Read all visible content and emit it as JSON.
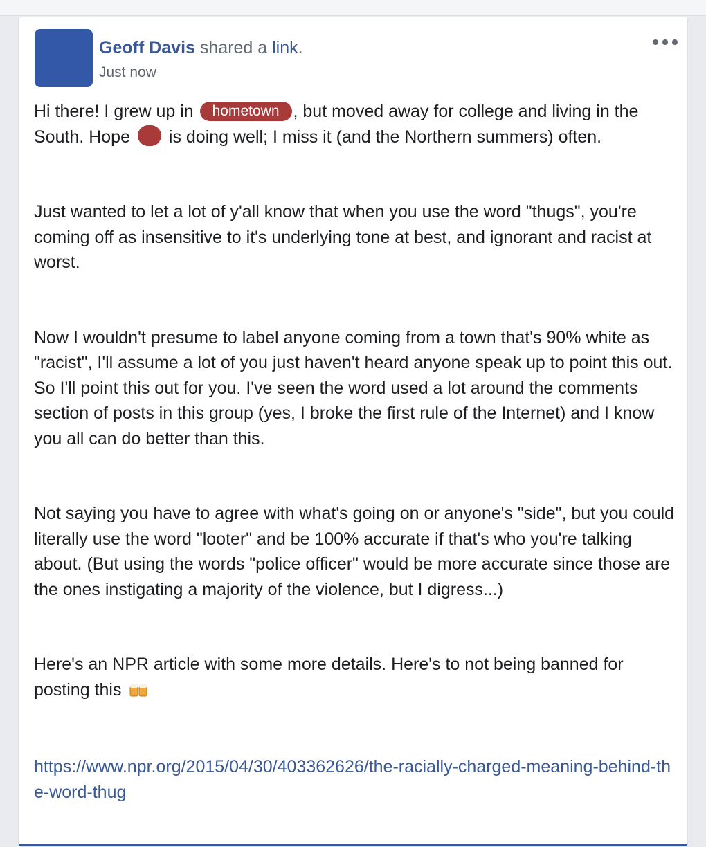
{
  "post": {
    "author": "Geoff Davis",
    "shared_text": " shared a ",
    "link_word": "link",
    "period": ".",
    "timestamp": "Just now",
    "colors": {
      "link": "#385898",
      "redaction": "#a83a3a",
      "avatar": "#3358a8"
    }
  },
  "body": {
    "p1_a": "Hi there! I grew up in ",
    "p1_redact": "hometown",
    "p1_b": ", but moved away for college and living in the South. Hope ",
    "p1_c": " is doing well; I miss it (and the Northern summers) often.",
    "p2": "Just wanted to let a lot of y'all know that when you use the word \"thugs\", you're coming off as insensitive to it's underlying tone at best, and ignorant and racist at worst.",
    "p3": "Now I wouldn't presume to label anyone coming from a town that's 90% white as \"racist\", I'll assume a lot of you just haven't heard anyone speak up to point this out. So I'll point this out for you. I've seen the word used a lot around the comments section of posts in this group (yes, I broke the first rule of the Internet) and I know you all can do better than this.",
    "p4": "Not saying you have to agree with what's going on or anyone's \"side\", but you could literally use the word \"looter\" and be 100% accurate if that's who you're talking about. (But using the words \"police officer\" would be more accurate since those are the ones instigating a majority of the violence, but I digress...)",
    "p5": "Here's an NPR article with some more details. Here's to not being banned for posting this ",
    "emoji_icon": "beer-mugs-icon",
    "url": "https://www.npr.org/2015/04/30/403362626/the-racially-charged-meaning-behind-the-word-thug"
  }
}
